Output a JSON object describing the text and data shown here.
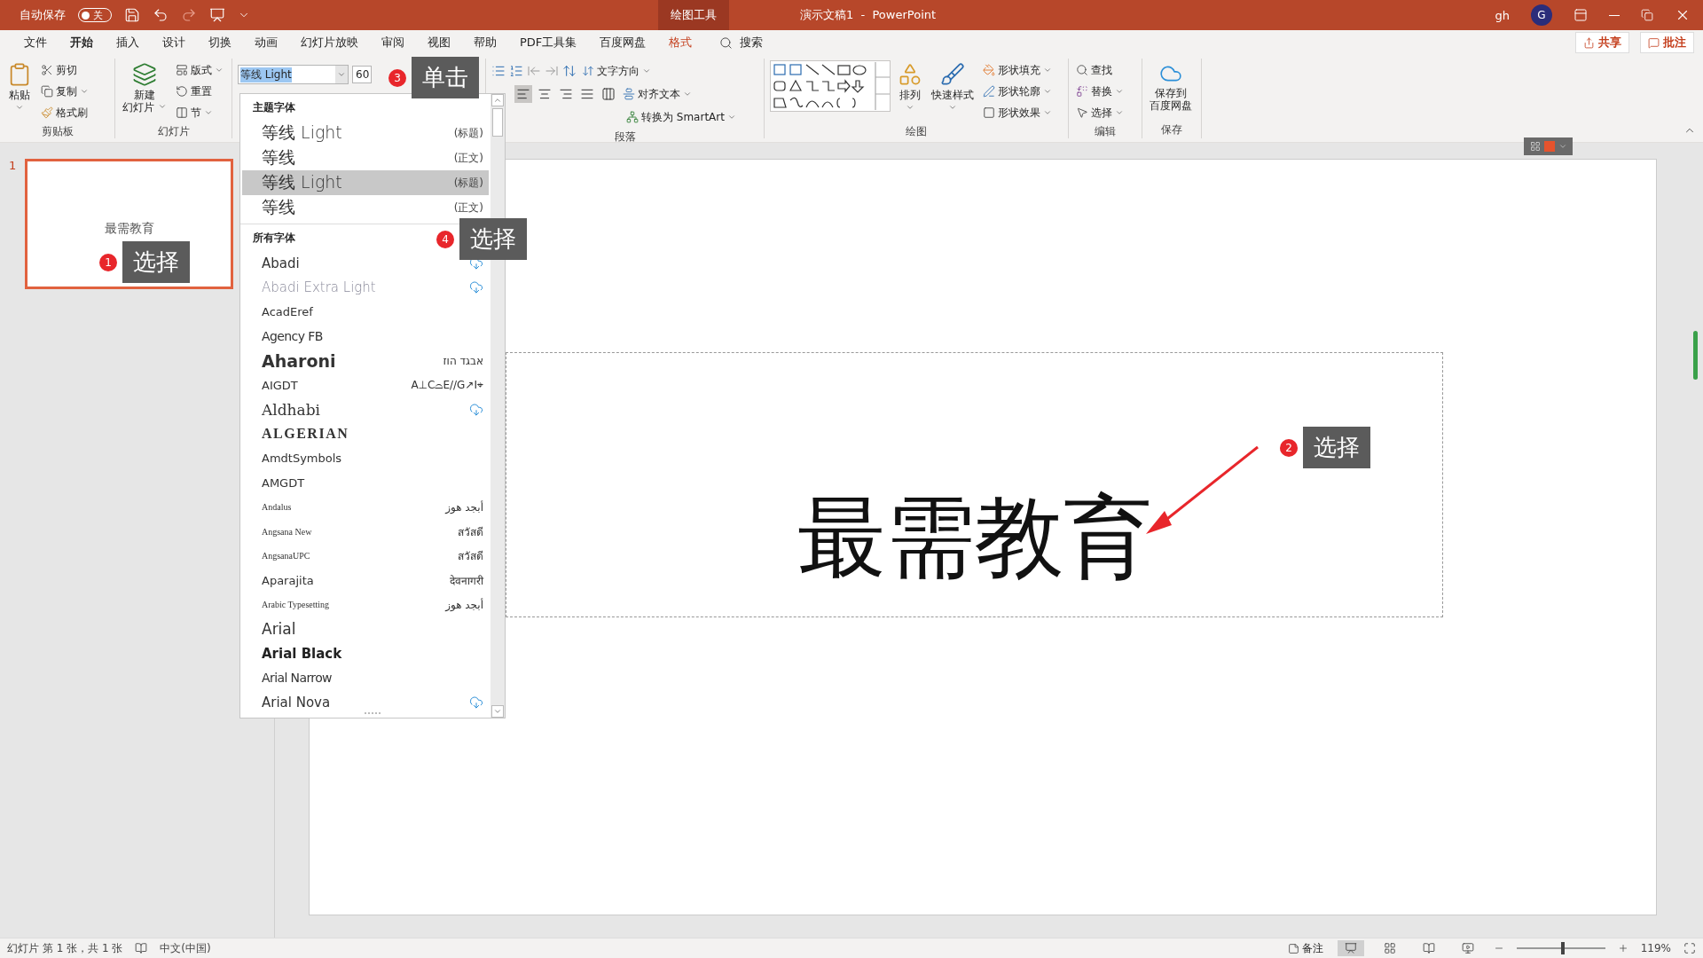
{
  "title_bar": {
    "autosave": {
      "label": "自动保存",
      "state_text": "关",
      "on": false
    },
    "context_tab": "绘图工具",
    "title": "演示文稿1  -  PowerPoint",
    "user": "gh",
    "avatar": "G"
  },
  "menu": {
    "tabs": [
      {
        "label": "文件",
        "selected": false,
        "kind": "normal"
      },
      {
        "label": "开始",
        "selected": true,
        "kind": "normal"
      },
      {
        "label": "插入",
        "selected": false,
        "kind": "normal"
      },
      {
        "label": "设计",
        "selected": false,
        "kind": "normal"
      },
      {
        "label": "切换",
        "selected": false,
        "kind": "normal"
      },
      {
        "label": "动画",
        "selected": false,
        "kind": "normal"
      },
      {
        "label": "幻灯片放映",
        "selected": false,
        "kind": "normal"
      },
      {
        "label": "审阅",
        "selected": false,
        "kind": "normal"
      },
      {
        "label": "视图",
        "selected": false,
        "kind": "normal"
      },
      {
        "label": "帮助",
        "selected": false,
        "kind": "normal"
      },
      {
        "label": "PDF工具集",
        "selected": false,
        "kind": "normal"
      },
      {
        "label": "百度网盘",
        "selected": false,
        "kind": "normal"
      },
      {
        "label": "格式",
        "selected": false,
        "kind": "context"
      }
    ],
    "search": "搜索",
    "share": "共享",
    "comments": "批注"
  },
  "ribbon": {
    "clipboard": {
      "paste": "粘贴",
      "cut": "剪切",
      "copy": "复制",
      "format_painter": "格式刷",
      "label": "剪贴板"
    },
    "slides": {
      "new_slide": [
        "新建",
        "幻灯片"
      ],
      "layout": "版式",
      "reset": "重置",
      "section": "节",
      "label": "幻灯片"
    },
    "font": {
      "font_name": "等线 Light",
      "font_size": "60"
    },
    "paragraph": {
      "alignment": [
        {
          "selected": true
        },
        {
          "selected": false
        },
        {
          "selected": false
        },
        {
          "selected": false
        },
        {
          "selected": false
        }
      ],
      "text_direction": "文字方向",
      "align_text": "对齐文本",
      "smartart": "转换为 SmartArt",
      "label": "段落"
    },
    "drawing": {
      "arrange": "排列",
      "quick_styles": "快速样式",
      "fill": "形状填充",
      "outline": "形状轮廓",
      "effects": "形状效果",
      "label": "绘图"
    },
    "editing": {
      "find": "查找",
      "replace": "替换",
      "select": "选择",
      "label": "编辑"
    },
    "save": {
      "button": [
        "保存到",
        "百度网盘"
      ],
      "label": "保存"
    }
  },
  "font_menu": {
    "sections": [
      {
        "heading": "主题字体",
        "items": [
          {
            "name": "等线 Light",
            "tag": "(标题)",
            "kind": "theme",
            "selected": false
          },
          {
            "name": "等线",
            "tag": "(正文)",
            "kind": "theme",
            "selected": false
          },
          {
            "name": "等线 Light",
            "tag": "(标题)",
            "kind": "theme",
            "selected": true
          },
          {
            "name": "等线",
            "tag": "(正文)",
            "kind": "theme",
            "selected": false
          }
        ]
      },
      {
        "heading": "所有字体",
        "items": [
          {
            "name": "Abadi",
            "kind": "regular",
            "cloud": true,
            "selected": false
          },
          {
            "name": "Abadi Extra Light",
            "kind": "light",
            "cloud": true,
            "selected": false
          },
          {
            "name": "AcadEref",
            "kind": "small",
            "selected": false
          },
          {
            "name": "Agency FB",
            "kind": "condensed",
            "selected": false
          },
          {
            "name": "Aharoni",
            "kind": "heavy",
            "sample": "אבגד הוז",
            "selected": false
          },
          {
            "name": "AIGDT",
            "kind": "small",
            "sample": "A⊥C⌓E//G↗I⌖",
            "selected": false
          },
          {
            "name": "Aldhabi",
            "kind": "serif",
            "cloud": true,
            "selected": false
          },
          {
            "name": "ALGERIAN",
            "kind": "decorative",
            "selected": false
          },
          {
            "name": "AmdtSymbols",
            "kind": "small",
            "selected": false
          },
          {
            "name": "AMGDT",
            "kind": "small",
            "selected": false
          },
          {
            "name": "Andalus",
            "kind": "tiny",
            "sample": "أبجد هوز",
            "selected": false
          },
          {
            "name": "Angsana New",
            "kind": "tiny",
            "sample": "สวัสดี",
            "selected": false
          },
          {
            "name": "AngsanaUPC",
            "kind": "tiny",
            "sample": "สวัสดี",
            "selected": false
          },
          {
            "name": "Aparajita",
            "kind": "small",
            "sample": "देवनागरी",
            "selected": false
          },
          {
            "name": "Arabic Typesetting",
            "kind": "tiny",
            "sample": "أبجد هوز",
            "selected": false
          },
          {
            "name": "Arial",
            "kind": "large",
            "selected": false
          },
          {
            "name": "Arial Black",
            "kind": "black",
            "selected": false
          },
          {
            "name": "Arial Narrow",
            "kind": "condensed",
            "selected": false
          },
          {
            "name": "Arial Nova",
            "kind": "regular",
            "cloud": true,
            "selected": false
          }
        ]
      }
    ]
  },
  "thumbnails": [
    {
      "number": "1",
      "text": "最需教育",
      "selected": true
    }
  ],
  "slide": {
    "title": "最需教育"
  },
  "callouts": [
    {
      "number": "1",
      "text": "选择"
    },
    {
      "number": "2",
      "text": "选择"
    },
    {
      "number": "3",
      "text": "单击"
    },
    {
      "number": "4",
      "text": "选择"
    }
  ],
  "status_bar": {
    "slide_info": "幻灯片 第 1 张，共 1 张",
    "language": "中文(中国)",
    "notes": "备注",
    "views": [
      {
        "selected": true
      },
      {
        "selected": false
      },
      {
        "selected": false
      },
      {
        "selected": false
      }
    ],
    "zoom": {
      "level": 0.52,
      "reading": "119%"
    }
  }
}
